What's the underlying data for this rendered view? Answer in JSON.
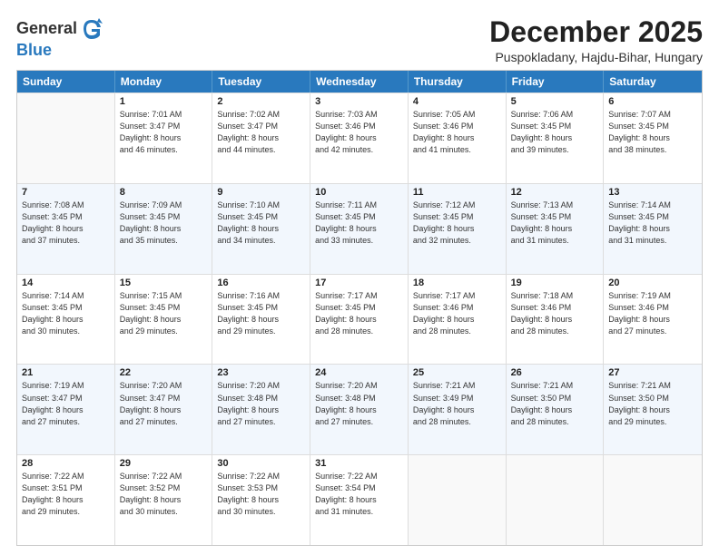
{
  "header": {
    "logo_general": "General",
    "logo_blue": "Blue",
    "month_title": "December 2025",
    "location": "Puspokladany, Hajdu-Bihar, Hungary"
  },
  "days_of_week": [
    "Sunday",
    "Monday",
    "Tuesday",
    "Wednesday",
    "Thursday",
    "Friday",
    "Saturday"
  ],
  "weeks": [
    [
      {
        "day": "",
        "lines": []
      },
      {
        "day": "1",
        "lines": [
          "Sunrise: 7:01 AM",
          "Sunset: 3:47 PM",
          "Daylight: 8 hours",
          "and 46 minutes."
        ]
      },
      {
        "day": "2",
        "lines": [
          "Sunrise: 7:02 AM",
          "Sunset: 3:47 PM",
          "Daylight: 8 hours",
          "and 44 minutes."
        ]
      },
      {
        "day": "3",
        "lines": [
          "Sunrise: 7:03 AM",
          "Sunset: 3:46 PM",
          "Daylight: 8 hours",
          "and 42 minutes."
        ]
      },
      {
        "day": "4",
        "lines": [
          "Sunrise: 7:05 AM",
          "Sunset: 3:46 PM",
          "Daylight: 8 hours",
          "and 41 minutes."
        ]
      },
      {
        "day": "5",
        "lines": [
          "Sunrise: 7:06 AM",
          "Sunset: 3:45 PM",
          "Daylight: 8 hours",
          "and 39 minutes."
        ]
      },
      {
        "day": "6",
        "lines": [
          "Sunrise: 7:07 AM",
          "Sunset: 3:45 PM",
          "Daylight: 8 hours",
          "and 38 minutes."
        ]
      }
    ],
    [
      {
        "day": "7",
        "lines": [
          "Sunrise: 7:08 AM",
          "Sunset: 3:45 PM",
          "Daylight: 8 hours",
          "and 37 minutes."
        ]
      },
      {
        "day": "8",
        "lines": [
          "Sunrise: 7:09 AM",
          "Sunset: 3:45 PM",
          "Daylight: 8 hours",
          "and 35 minutes."
        ]
      },
      {
        "day": "9",
        "lines": [
          "Sunrise: 7:10 AM",
          "Sunset: 3:45 PM",
          "Daylight: 8 hours",
          "and 34 minutes."
        ]
      },
      {
        "day": "10",
        "lines": [
          "Sunrise: 7:11 AM",
          "Sunset: 3:45 PM",
          "Daylight: 8 hours",
          "and 33 minutes."
        ]
      },
      {
        "day": "11",
        "lines": [
          "Sunrise: 7:12 AM",
          "Sunset: 3:45 PM",
          "Daylight: 8 hours",
          "and 32 minutes."
        ]
      },
      {
        "day": "12",
        "lines": [
          "Sunrise: 7:13 AM",
          "Sunset: 3:45 PM",
          "Daylight: 8 hours",
          "and 31 minutes."
        ]
      },
      {
        "day": "13",
        "lines": [
          "Sunrise: 7:14 AM",
          "Sunset: 3:45 PM",
          "Daylight: 8 hours",
          "and 31 minutes."
        ]
      }
    ],
    [
      {
        "day": "14",
        "lines": [
          "Sunrise: 7:14 AM",
          "Sunset: 3:45 PM",
          "Daylight: 8 hours",
          "and 30 minutes."
        ]
      },
      {
        "day": "15",
        "lines": [
          "Sunrise: 7:15 AM",
          "Sunset: 3:45 PM",
          "Daylight: 8 hours",
          "and 29 minutes."
        ]
      },
      {
        "day": "16",
        "lines": [
          "Sunrise: 7:16 AM",
          "Sunset: 3:45 PM",
          "Daylight: 8 hours",
          "and 29 minutes."
        ]
      },
      {
        "day": "17",
        "lines": [
          "Sunrise: 7:17 AM",
          "Sunset: 3:45 PM",
          "Daylight: 8 hours",
          "and 28 minutes."
        ]
      },
      {
        "day": "18",
        "lines": [
          "Sunrise: 7:17 AM",
          "Sunset: 3:46 PM",
          "Daylight: 8 hours",
          "and 28 minutes."
        ]
      },
      {
        "day": "19",
        "lines": [
          "Sunrise: 7:18 AM",
          "Sunset: 3:46 PM",
          "Daylight: 8 hours",
          "and 28 minutes."
        ]
      },
      {
        "day": "20",
        "lines": [
          "Sunrise: 7:19 AM",
          "Sunset: 3:46 PM",
          "Daylight: 8 hours",
          "and 27 minutes."
        ]
      }
    ],
    [
      {
        "day": "21",
        "lines": [
          "Sunrise: 7:19 AM",
          "Sunset: 3:47 PM",
          "Daylight: 8 hours",
          "and 27 minutes."
        ]
      },
      {
        "day": "22",
        "lines": [
          "Sunrise: 7:20 AM",
          "Sunset: 3:47 PM",
          "Daylight: 8 hours",
          "and 27 minutes."
        ]
      },
      {
        "day": "23",
        "lines": [
          "Sunrise: 7:20 AM",
          "Sunset: 3:48 PM",
          "Daylight: 8 hours",
          "and 27 minutes."
        ]
      },
      {
        "day": "24",
        "lines": [
          "Sunrise: 7:20 AM",
          "Sunset: 3:48 PM",
          "Daylight: 8 hours",
          "and 27 minutes."
        ]
      },
      {
        "day": "25",
        "lines": [
          "Sunrise: 7:21 AM",
          "Sunset: 3:49 PM",
          "Daylight: 8 hours",
          "and 28 minutes."
        ]
      },
      {
        "day": "26",
        "lines": [
          "Sunrise: 7:21 AM",
          "Sunset: 3:50 PM",
          "Daylight: 8 hours",
          "and 28 minutes."
        ]
      },
      {
        "day": "27",
        "lines": [
          "Sunrise: 7:21 AM",
          "Sunset: 3:50 PM",
          "Daylight: 8 hours",
          "and 29 minutes."
        ]
      }
    ],
    [
      {
        "day": "28",
        "lines": [
          "Sunrise: 7:22 AM",
          "Sunset: 3:51 PM",
          "Daylight: 8 hours",
          "and 29 minutes."
        ]
      },
      {
        "day": "29",
        "lines": [
          "Sunrise: 7:22 AM",
          "Sunset: 3:52 PM",
          "Daylight: 8 hours",
          "and 30 minutes."
        ]
      },
      {
        "day": "30",
        "lines": [
          "Sunrise: 7:22 AM",
          "Sunset: 3:53 PM",
          "Daylight: 8 hours",
          "and 30 minutes."
        ]
      },
      {
        "day": "31",
        "lines": [
          "Sunrise: 7:22 AM",
          "Sunset: 3:54 PM",
          "Daylight: 8 hours",
          "and 31 minutes."
        ]
      },
      {
        "day": "",
        "lines": []
      },
      {
        "day": "",
        "lines": []
      },
      {
        "day": "",
        "lines": []
      }
    ]
  ]
}
